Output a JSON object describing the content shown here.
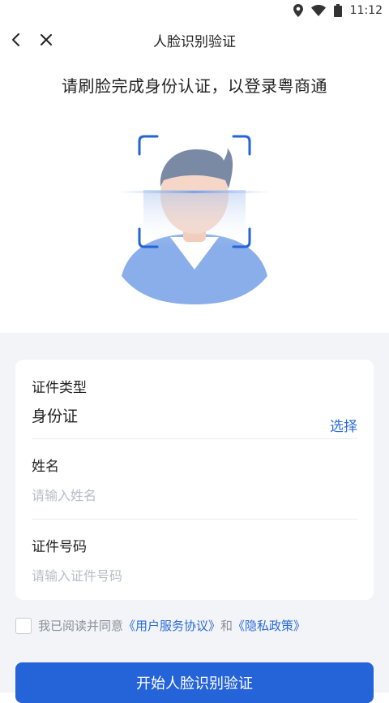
{
  "status": {
    "time": "11:12"
  },
  "nav": {
    "title": "人脸识别验证"
  },
  "subtitle": "请刷脸完成身份认证，以登录粤商通",
  "form": {
    "id_type_label": "证件类型",
    "id_type_value": "身份证",
    "select_label": "选择",
    "name_label": "姓名",
    "name_placeholder": "请输入姓名",
    "id_number_label": "证件号码",
    "id_number_placeholder": "请输入证件号码"
  },
  "agreement": {
    "prefix": "我已阅读并同意",
    "user_agreement": "《用户服务协议》",
    "and": "和",
    "privacy_policy": "《隐私政策》",
    "checked": false
  },
  "start_button": "开始人脸识别验证",
  "colors": {
    "accent": "#2563d9",
    "link": "#2b6bd8",
    "background": "#f2f4f7"
  }
}
